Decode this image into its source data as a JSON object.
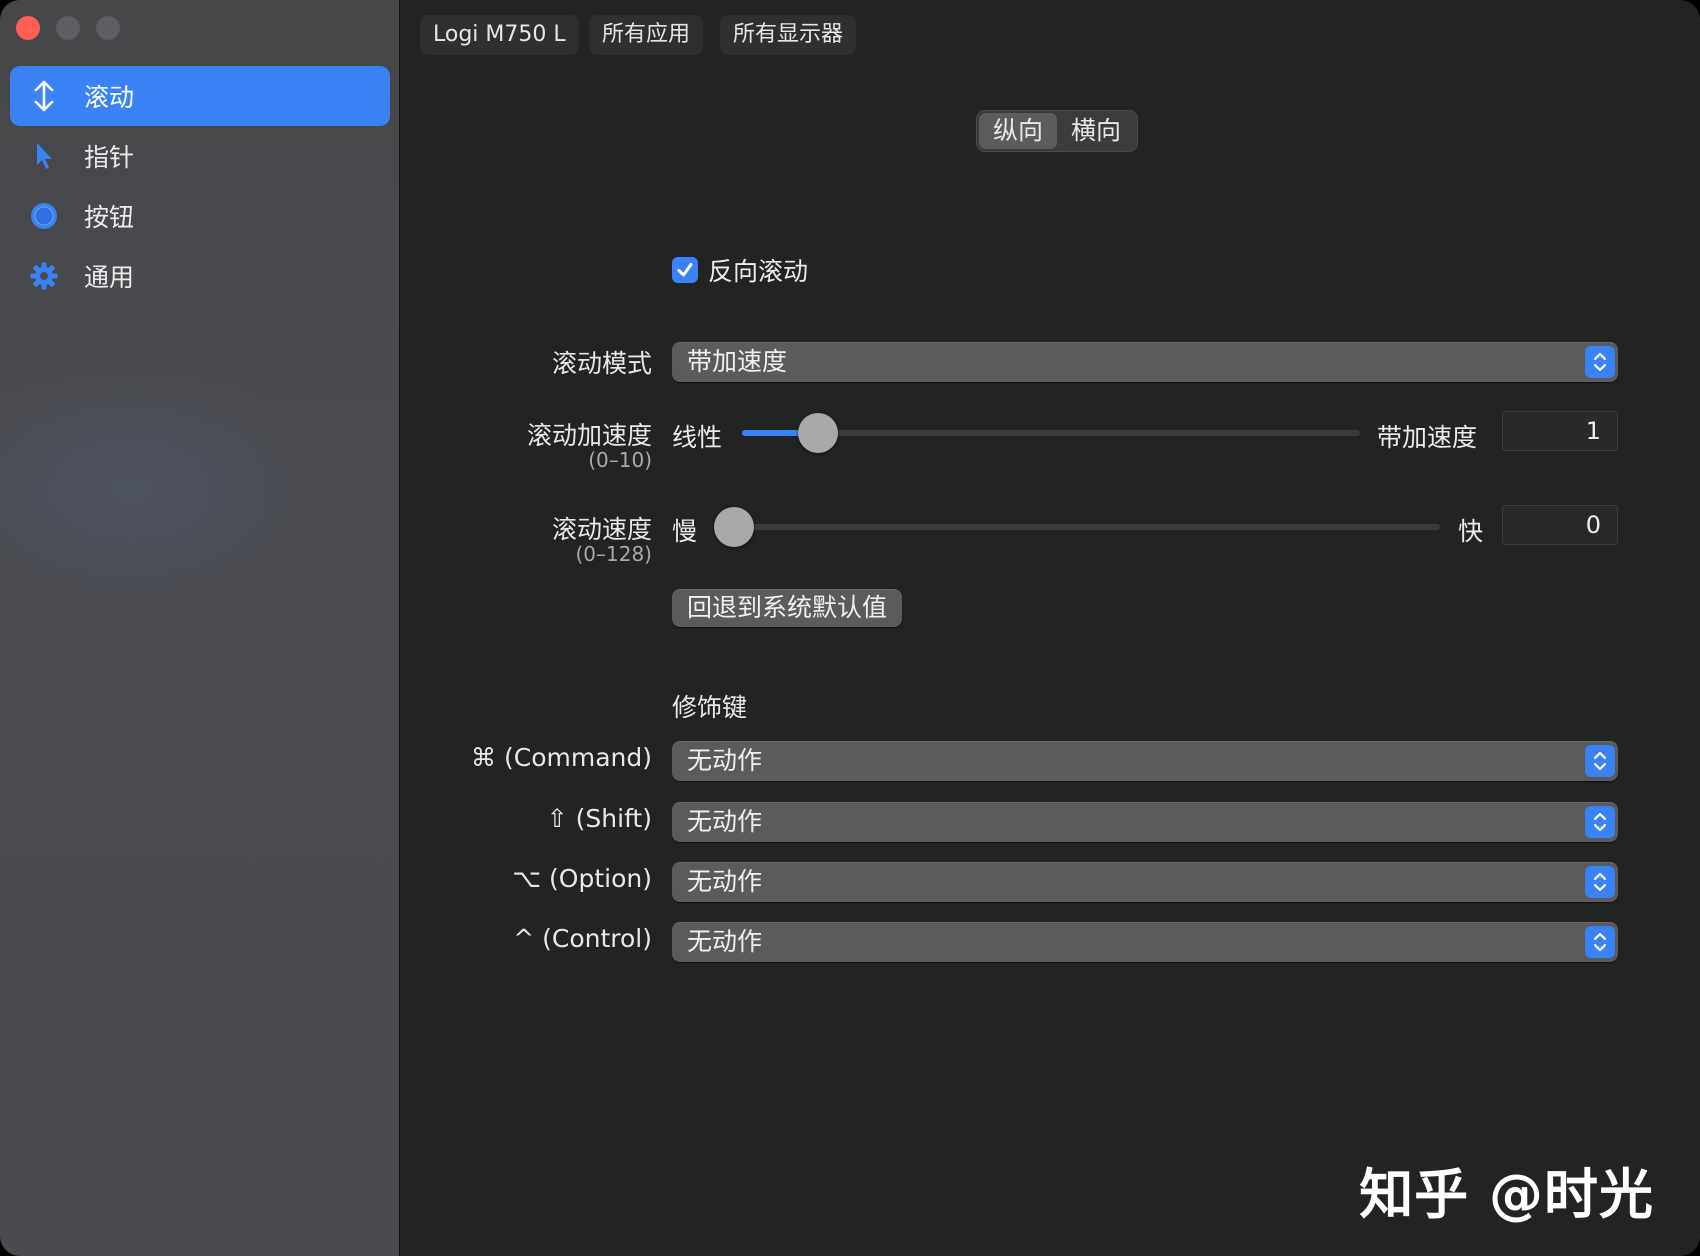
{
  "window": {
    "traffic_lights": {
      "close": "#ff5f57",
      "minimize": "#5d5e61",
      "zoom": "#5d5e61"
    }
  },
  "sidebar": {
    "items": [
      {
        "label": "滚动",
        "icon": "scroll-arrows-icon",
        "active": true
      },
      {
        "label": "指针",
        "icon": "pointer-icon",
        "active": false
      },
      {
        "label": "按钮",
        "icon": "button-circle-icon",
        "active": false
      },
      {
        "label": "通用",
        "icon": "gear-icon",
        "active": false
      }
    ]
  },
  "toolbar": {
    "device": "Logi M750 L",
    "apps": "所有应用",
    "displays": "所有显示器"
  },
  "orientation": {
    "vertical": "纵向",
    "horizontal": "横向",
    "selected": "纵向"
  },
  "reverse_scroll": {
    "label": "反向滚动",
    "checked": true
  },
  "scroll_mode": {
    "label": "滚动模式",
    "value": "带加速度"
  },
  "acceleration": {
    "label": "滚动加速度",
    "range": "(0–10)",
    "min_label": "线性",
    "max_label": "带加速度",
    "value": "1",
    "level": 0.1
  },
  "speed": {
    "label": "滚动速度",
    "range": "(0–128)",
    "min_label": "慢",
    "max_label": "快",
    "value": "0",
    "level": 0
  },
  "reset_button": "回退到系统默认值",
  "modifiers": {
    "title": "修饰键",
    "rows": [
      {
        "key": "⌘ (Command)",
        "value": "无动作"
      },
      {
        "key": "⇧ (Shift)",
        "value": "无动作"
      },
      {
        "key": "⌥ (Option)",
        "value": "无动作"
      },
      {
        "key": "^ (Control)",
        "value": "无动作"
      }
    ]
  },
  "watermark": "知乎 @时光",
  "colors": {
    "accent": "#3b82f7",
    "background": "#222323",
    "sidebar": "#48494c"
  }
}
